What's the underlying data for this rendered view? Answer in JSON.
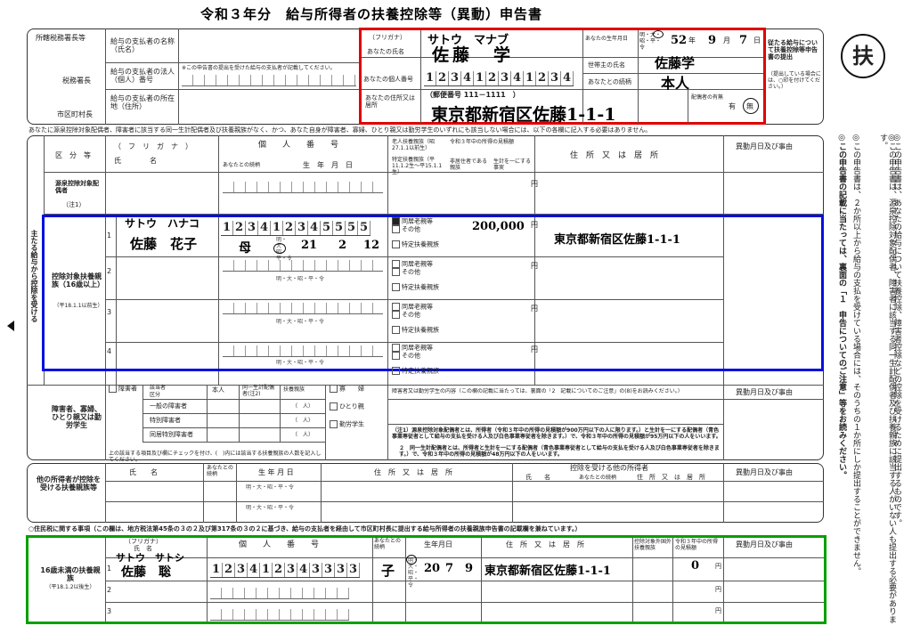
{
  "title": "令和３年分　給与所得者の扶養控除等（異動）申告書",
  "badge": "扶",
  "header": {
    "tax_office": "所轄税務署長等",
    "tax_office_suffix": "税務署長",
    "city_suffix": "市区町村長",
    "payer_name": "給与の支払者の名称（氏名）",
    "payer_number": "給与の支払者の法人（個人）番号",
    "payer_number_note": "※この申告書の提出を受けた給与の支払者が記載してください。",
    "payer_address": "給与の支払者の所在地（住所）",
    "furigana_label": "（フリガナ）",
    "furigana_value": "サトウ　マナブ",
    "name_label": "あなたの氏名",
    "name_value": "佐藤　学",
    "mynumber_label": "あなたの個人番号",
    "mynumber_digits": [
      "1",
      "2",
      "3",
      "4",
      "1",
      "2",
      "3",
      "4",
      "1",
      "2",
      "3",
      "4"
    ],
    "address_label": "あなたの住所又は居所",
    "postal": "（郵便番号 111－1111　）",
    "address_value": "東京都新宿区佐藤1-1-1",
    "birth_label": "あなたの生年月日",
    "era_options": "明・大・昭・平・令",
    "birth_year": "52",
    "birth_month": "9",
    "birth_day": "7",
    "nen": "年",
    "gatsu": "月",
    "nichi": "日",
    "householder_label": "世帯主の氏名",
    "householder_value": "佐藤学",
    "relation_label": "あなたとの続柄",
    "relation_value": "本人",
    "spouse_label": "配偶者の有無",
    "spouse_yes": "有",
    "spouse_no": "無",
    "side_note": "従たる給与について扶養控除等申告書の提出",
    "side_note_sub": "（提出している場合には、○印を付けてください。）"
  },
  "notice": "あなたに源泉控除対象配偶者、障害者に該当する同一生計配偶者及び扶養親族がなく、かつ、あなた自身が障害者、寡婦、ひとり親又は勤労学生のいずれにも該当しない場合には、以下の各欄に記入する必要はありません。",
  "cols": {
    "kubun": "区　分　等",
    "furigana": "（　フ　リ　ガ　ナ　）",
    "shimei": "氏　　　　名",
    "kojin": "個　　人　　番　　号",
    "zokugara": "あなたとの続柄",
    "seinengappi": "生　年　月　日",
    "rojin": "老人扶養親族（昭27.1.1以前生）",
    "tokutei": "特定扶養親族（平11.1.2生～平15.1.1生）",
    "shotoku": "令和３年中の所得の見積額",
    "hikyo": "非居住者である親族",
    "seikei": "生計を一にする事実",
    "jusho": "住　所　又　は　居　所",
    "ido": "異動月日及び事由",
    "en": "円"
  },
  "sectionA": {
    "label": "源泉控除対象配偶者",
    "note": "（注1）"
  },
  "sectionB": {
    "main": "主たる給与から控除を受ける",
    "label": "控除対象扶養親族（16歳以上）",
    "note": "（平18.1.1以前生）",
    "opt1": "同居老親等",
    "opt2": "その他",
    "opt3": "特定扶養親族",
    "row1": {
      "furigana": "サトウ　ハナコ",
      "name": "佐藤　花子",
      "digits": [
        "1",
        "2",
        "3",
        "4",
        "1",
        "2",
        "3",
        "4",
        "5",
        "5",
        "5",
        "5"
      ],
      "relation": "母",
      "year": "21",
      "month": "2",
      "day": "12",
      "income": "200,000",
      "address": "東京都新宿区佐藤1-1-1"
    }
  },
  "sectionC": {
    "label": "障害者、寡婦、ひとり親又は勤労学生",
    "disabled": "障害者",
    "kubun": "区分",
    "applicable": "該当者",
    "self": "本人",
    "spouse": "同一生計配偶者(注2)",
    "dependents": "扶養親族",
    "ippan": "一般の障害者",
    "tokubetsu": "特別障害者",
    "doukyo": "同居特別障害者",
    "nin": "（　人）",
    "widow": "寡　　婦",
    "single": "ひとり親",
    "student": "勤労学生",
    "detail": "障害者又は勤労学生の内容（この欄の記載に当たっては、裏面の「2　記載についてのご注意」の(8)をお読みください。）",
    "check_note": "上の該当する項目及び欄にチェックを付け、(　)内には該当する扶養親族の人数を記入してください。",
    "note1": "（注1）源泉控除対象配偶者とは、所得者（令和３年中の所得の見積額が900万円以下の人に限ります。）と生計を一にする配偶者（青色事業専従者として給与の支払を受ける人及び白色事業専従者を除きます。）で、令和３年中の所得の見積額が95万円以下の人をいいます。",
    "note2": "２　同一生計配偶者とは、所得者と生計を一にする配偶者（青色事業専従者として給与の支払を受ける人及び白色事業専従者を除きます。）で、令和３年中の所得の見積額が48万円以下の人をいいます。"
  },
  "sectionD": {
    "label": "他の所得者が控除を受ける扶養親族等",
    "shimei": "氏　　名",
    "zokugara": "あなたとの続柄",
    "seinengappi": "生 年 月 日",
    "jusho": "住　所　又　は　居　所",
    "other": "控除を受ける他の所得者",
    "other_name": "氏　　名",
    "other_rel": "あなたとの続柄",
    "other_addr": "住　所　又　は　居　所",
    "ido": "異動月日及び事由"
  },
  "resident_title": "○住民税に関する事項（この欄は、地方税法第45条の３の２及び第317条の３の２に基づき、給与の支払者を経由して市区町村長に提出する給与所得者の扶養親族申告書の記載欄を兼ねています。）",
  "sectionU16": {
    "label": "16歳未満の扶養親族",
    "note": "（平18.1.2以後生）",
    "furigana_h": "（フリガナ）",
    "shimei_h": "氏　名",
    "kojin_h": "個　　人　　番　　号",
    "zokugara_h": "あなたとの続柄",
    "seinengappi_h": "生年月日",
    "jusho_h": "住　所　又　は　居　所",
    "kokugai_h": "控除対象外国外扶養親族",
    "shotoku_h": "令和３年中の所得の見積額",
    "ido_h": "異動月日及び事由",
    "row1": {
      "furigana": "サトウ　サトシ",
      "name": "佐藤　聡",
      "digits": [
        "1",
        "2",
        "3",
        "4",
        "1",
        "2",
        "3",
        "4",
        "3",
        "3",
        "3",
        "3"
      ],
      "relation": "子",
      "year": "20",
      "month": "7",
      "day": "9",
      "address": "東京都新宿区佐藤1-1-1",
      "income": "0"
    }
  },
  "row_numbers": [
    "1",
    "2",
    "3",
    "4"
  ],
  "right_notes": [
    "◎この申告書は、あなたの給与について扶養控除、障害者控除などの控除を受けるために提出するものです。",
    "◎この申告書は、源泉控除対象配偶者、障害者に該当する同一生計配偶者及び扶養親族に該当する人がいない人も提出する必要があります。",
    "◎この申告書は、２か所以上から給与の支払を受けている場合には、そのうちの１か所にしか提出することができません。",
    "◎この申告書の記載に当たっては、裏面の「１　申告についてのご注意」等をお読みください。"
  ],
  "colors": {
    "red": "#e00000",
    "blue": "#0010e0",
    "green": "#00a000"
  }
}
